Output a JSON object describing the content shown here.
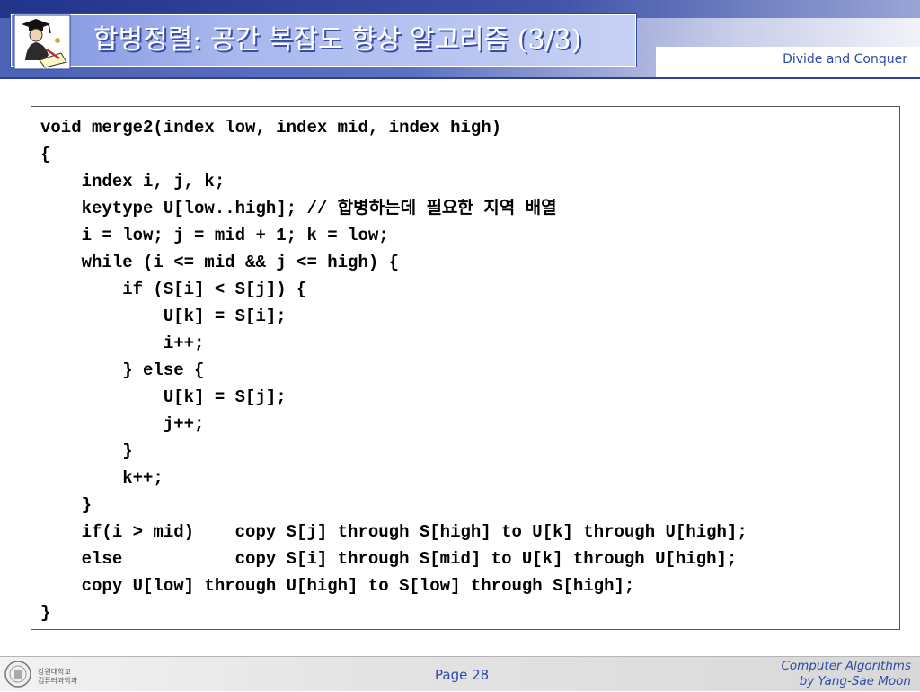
{
  "header": {
    "title": "합병정렬: 공간 복잡도 향상 알고리즘 (3/3)",
    "course_tag": "Divide and Conquer"
  },
  "code": {
    "lines": [
      "void merge2(index low, index mid, index high)",
      "{",
      "    index i, j, k;",
      "    keytype U[low..high]; // 합병하는데 필요한 지역 배열",
      "    i = low; j = mid + 1; k = low;",
      "    while (i <= mid && j <= high) {",
      "        if (S[i] < S[j]) {",
      "            U[k] = S[i];",
      "            i++;",
      "        } else {",
      "            U[k] = S[j];",
      "            j++;",
      "        }",
      "        k++;",
      "    }",
      "    if(i > mid)    copy S[j] through S[high] to U[k] through U[high];",
      "    else           copy S[i] through S[mid] to U[k] through U[high];",
      "    copy U[low] through U[high] to S[low] through S[high];",
      "}"
    ]
  },
  "footer": {
    "department": [
      "강원대학교",
      "컴퓨터과학과"
    ],
    "page": "Page 28",
    "credit_line1": "Computer Algorithms",
    "credit_line2": "by Yang-Sae Moon"
  },
  "icons": {
    "header_logo": "scholar-writing-icon",
    "footer_logo": "university-seal-icon"
  },
  "colors": {
    "header_blue": "#4d63b5",
    "accent_text": "#2d4aa8"
  }
}
